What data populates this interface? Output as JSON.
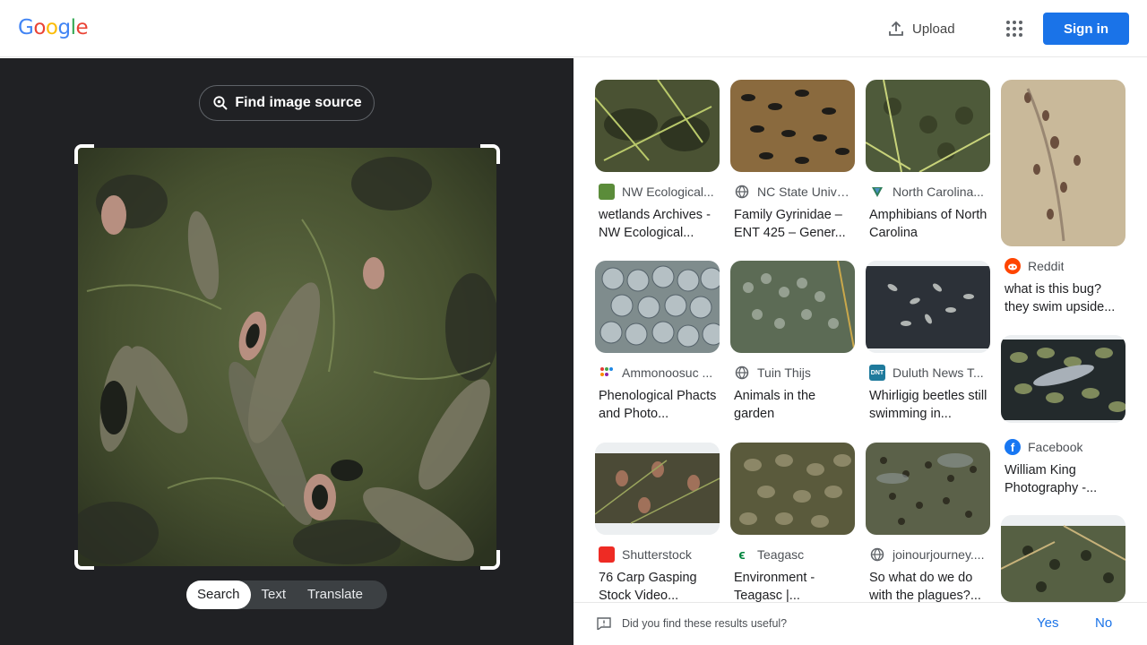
{
  "header": {
    "logo": {
      "letters": [
        "G",
        "o",
        "o",
        "g",
        "l",
        "e"
      ],
      "colors": [
        "#4285f4",
        "#ea4335",
        "#fbbc05",
        "#4285f4",
        "#34a853",
        "#ea4335"
      ]
    },
    "upload_label": "Upload",
    "signin_label": "Sign in"
  },
  "left_pane": {
    "find_source_label": "Find image source",
    "modes": [
      "Search",
      "Text",
      "Translate"
    ],
    "active_mode": "Search"
  },
  "results": {
    "cards": [
      {
        "source": "NW Ecological...",
        "title": "wetlands Archives - NW Ecological...",
        "icon": "nw-ecological-favicon",
        "icon_color": "#5b8c3a"
      },
      {
        "source": "NC State Unive...",
        "title": "Family Gyrinidae – ENT 425 – Gener...",
        "icon": "globe-icon",
        "icon_color": "#5f6368"
      },
      {
        "source": "North Carolina...",
        "title": "Amphibians of North Carolina",
        "icon": "nc-favicon",
        "icon_color": "#2e7d5b"
      },
      {
        "source": "Reddit",
        "title": "what is this bug? they swim upside...",
        "icon": "reddit-icon",
        "icon_color": "#ff4500"
      },
      {
        "source": "Ammonoosuc ...",
        "title": "Phenological Phacts and Photo...",
        "icon": "ammonoosuc-favicon",
        "icon_color": "#e53935"
      },
      {
        "source": "Tuin Thijs",
        "title": "Animals in the garden",
        "icon": "globe-icon",
        "icon_color": "#5f6368"
      },
      {
        "source": "Duluth News T...",
        "title": "Whirligig beetles still swimming in...",
        "icon": "dnt-favicon",
        "icon_color": "#1f7a9c"
      },
      {
        "source": "Facebook",
        "title": "William King Photography -...",
        "icon": "facebook-icon",
        "icon_color": "#1877f2"
      },
      {
        "source": "Shutterstock",
        "title": "76 Carp Gasping Stock Video...",
        "icon": "shutterstock-icon",
        "icon_color": "#ee2b24"
      },
      {
        "source": "Teagasc",
        "title": "Environment - Teagasc |...",
        "icon": "teagasc-icon",
        "icon_color": "#00843d"
      },
      {
        "source": "joinourjourney....",
        "title": "So what do we do with the plagues?...",
        "icon": "globe-icon",
        "icon_color": "#5f6368"
      }
    ]
  },
  "feedback": {
    "question": "Did you find these results useful?",
    "yes": "Yes",
    "no": "No"
  }
}
